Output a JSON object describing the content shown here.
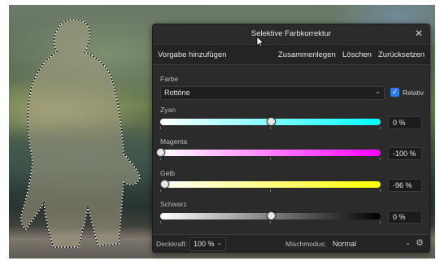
{
  "dialog": {
    "title": "Selektive Farbkorrektur",
    "close_icon": "close-icon",
    "toolbar": {
      "add_preset": "Vorgabe hinzufügen",
      "merge": "Zusammenlegen",
      "delete": "Löschen",
      "reset": "Zurücksetzen"
    },
    "color_label": "Farbe",
    "color_value": "Rottöne",
    "relative_label": "Relativ",
    "relative_checked": true,
    "sliders": [
      {
        "label": "Zyan",
        "value": 0,
        "value_text": "0 %",
        "from": "#ffffff",
        "to": "#00ffff"
      },
      {
        "label": "Magenta",
        "value": -100,
        "value_text": "-100 %",
        "from": "#ffffff",
        "to": "#ff00ff"
      },
      {
        "label": "Gelb",
        "value": -96,
        "value_text": "-96 %",
        "from": "#ffffff",
        "to": "#ffff00"
      },
      {
        "label": "Schwarz",
        "value": 0,
        "value_text": "0 %",
        "from": "#ffffff",
        "to": "#000000"
      }
    ],
    "footer": {
      "opacity_label": "Deckkraft:",
      "opacity_value": "100 %",
      "blend_label": "Mischmodus:",
      "blend_value": "Normal",
      "settings_icon": "gear-icon"
    }
  }
}
